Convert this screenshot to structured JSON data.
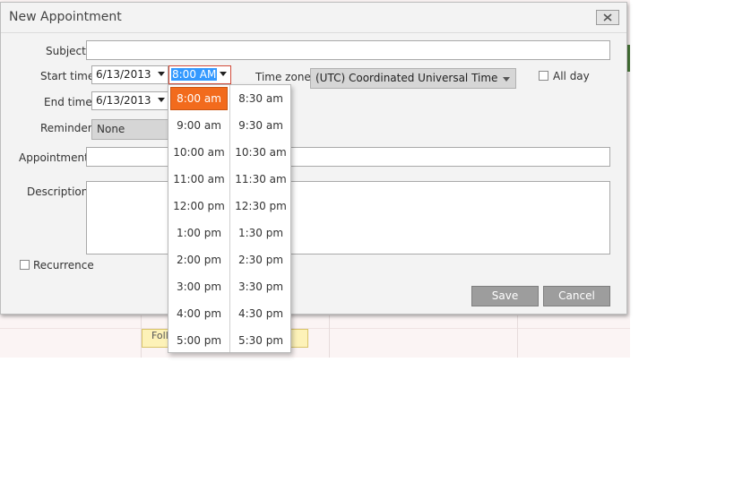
{
  "background": {
    "appointment_text": "Foll"
  },
  "dialog": {
    "title": "New Appointment",
    "labels": {
      "subject": "Subject",
      "start_time": "Start time",
      "end_time": "End time",
      "reminder": "Reminder",
      "appointment_type": "AppointmentT",
      "description": "Description",
      "time_zone": "Time zone",
      "all_day": "All day",
      "recurrence": "Recurrence"
    },
    "fields": {
      "subject_value": "",
      "start_date": "6/13/2013",
      "start_time": "8:00 AM",
      "end_date": "6/13/2013",
      "time_zone": "(UTC) Coordinated Universal Time",
      "reminder": "None",
      "appointment_type_value": "",
      "description_value": ""
    },
    "buttons": {
      "save": "Save",
      "cancel": "Cancel"
    },
    "colors": {
      "selected_slot": "#f26b1d",
      "time_input_border": "#d24b3a",
      "text_selection": "#3399ff"
    }
  },
  "time_dropdown": {
    "left_column": [
      "8:00 am",
      "9:00 am",
      "10:00 am",
      "11:00 am",
      "12:00 pm",
      "1:00 pm",
      "2:00 pm",
      "3:00 pm",
      "4:00 pm",
      "5:00 pm"
    ],
    "right_column": [
      "8:30 am",
      "9:30 am",
      "10:30 am",
      "11:30 am",
      "12:30 pm",
      "1:30 pm",
      "2:30 pm",
      "3:30 pm",
      "4:30 pm",
      "5:30 pm"
    ],
    "selected": "8:00 am"
  }
}
